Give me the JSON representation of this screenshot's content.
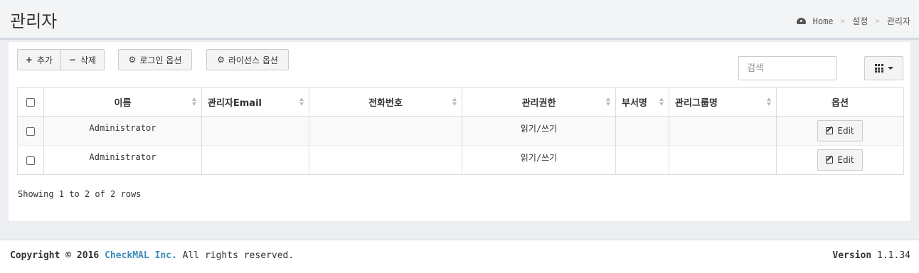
{
  "header": {
    "title": "관리자",
    "breadcrumb": {
      "home": "Home",
      "section": "설정",
      "current": "관리자"
    }
  },
  "toolbar": {
    "add_label": "추가",
    "delete_label": "삭제",
    "login_option_label": "로그인 옵션",
    "license_option_label": "라이선스 옵션",
    "search_placeholder": "검색"
  },
  "table": {
    "columns": [
      "이름",
      "관리자Email",
      "전화번호",
      "관리권한",
      "부서명",
      "관리그룹명",
      "옵션"
    ],
    "rows": [
      {
        "name": "Administrator",
        "email": "",
        "phone": "",
        "permission": "읽기/쓰기",
        "department": "",
        "group": "",
        "action": "Edit"
      },
      {
        "name": "Administrator",
        "email": "",
        "phone": "",
        "permission": "읽기/쓰기",
        "department": "",
        "group": "",
        "action": "Edit"
      }
    ],
    "pagination_info": "Showing 1 to 2 of 2 rows"
  },
  "footer": {
    "copyright_prefix": "Copyright © 2016",
    "company": "CheckMAL Inc.",
    "rights": "All rights reserved.",
    "version_label": "Version",
    "version_number": "1.1.34"
  }
}
